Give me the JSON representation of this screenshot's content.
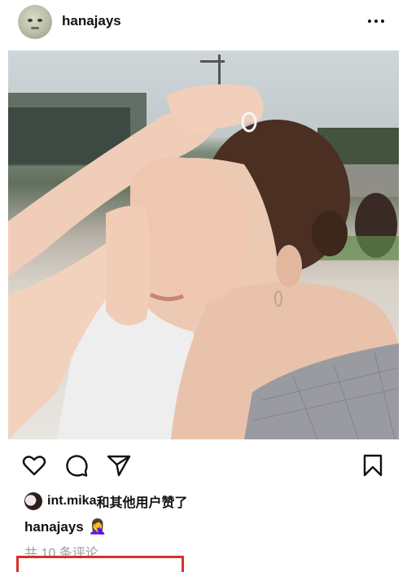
{
  "post": {
    "username": "hanajays",
    "more_icon": "more-horizontal-icon",
    "photo_alt": "photo"
  },
  "actions": {
    "like_icon": "heart-icon",
    "comment_icon": "comment-icon",
    "share_icon": "send-icon",
    "save_icon": "bookmark-icon"
  },
  "likes": {
    "liker": "int.mika",
    "suffix": "和其他用户赞了"
  },
  "caption": {
    "username": "hanajays",
    "emoji": "🤦‍♀️"
  },
  "comments": {
    "count_text": "共 10 条评论"
  },
  "colors": {
    "highlight": "#d9302a",
    "muted_text": "#9b9b9b"
  }
}
